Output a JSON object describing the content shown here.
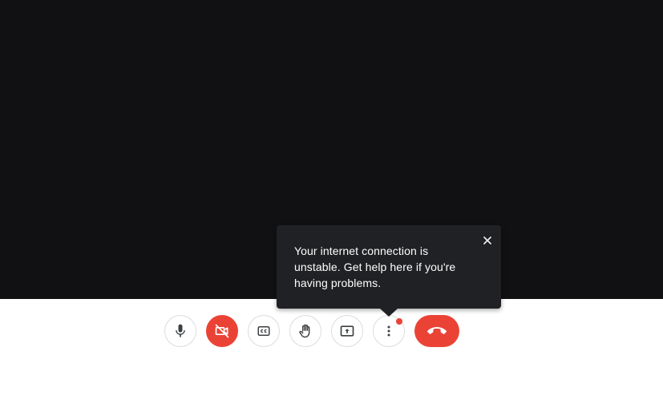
{
  "tooltip": {
    "message": "Your internet connection is unstable. Get help here if you're having problems."
  },
  "controls": {
    "microphone": {
      "icon": "microphone-icon",
      "state": "on"
    },
    "camera": {
      "icon": "camera-off-icon",
      "state": "off"
    },
    "captions": {
      "icon": "closed-captions-icon",
      "label": "CC"
    },
    "raise_hand": {
      "icon": "raise-hand-icon"
    },
    "present": {
      "icon": "present-screen-icon"
    },
    "more_options": {
      "icon": "more-vert-icon",
      "has_notification": true
    },
    "end_call": {
      "icon": "hang-up-phone-icon"
    }
  },
  "colors": {
    "stage_background": "#111113",
    "danger": "#ea4335",
    "tooltip_background": "#202124",
    "button_border": "#dadce0"
  }
}
